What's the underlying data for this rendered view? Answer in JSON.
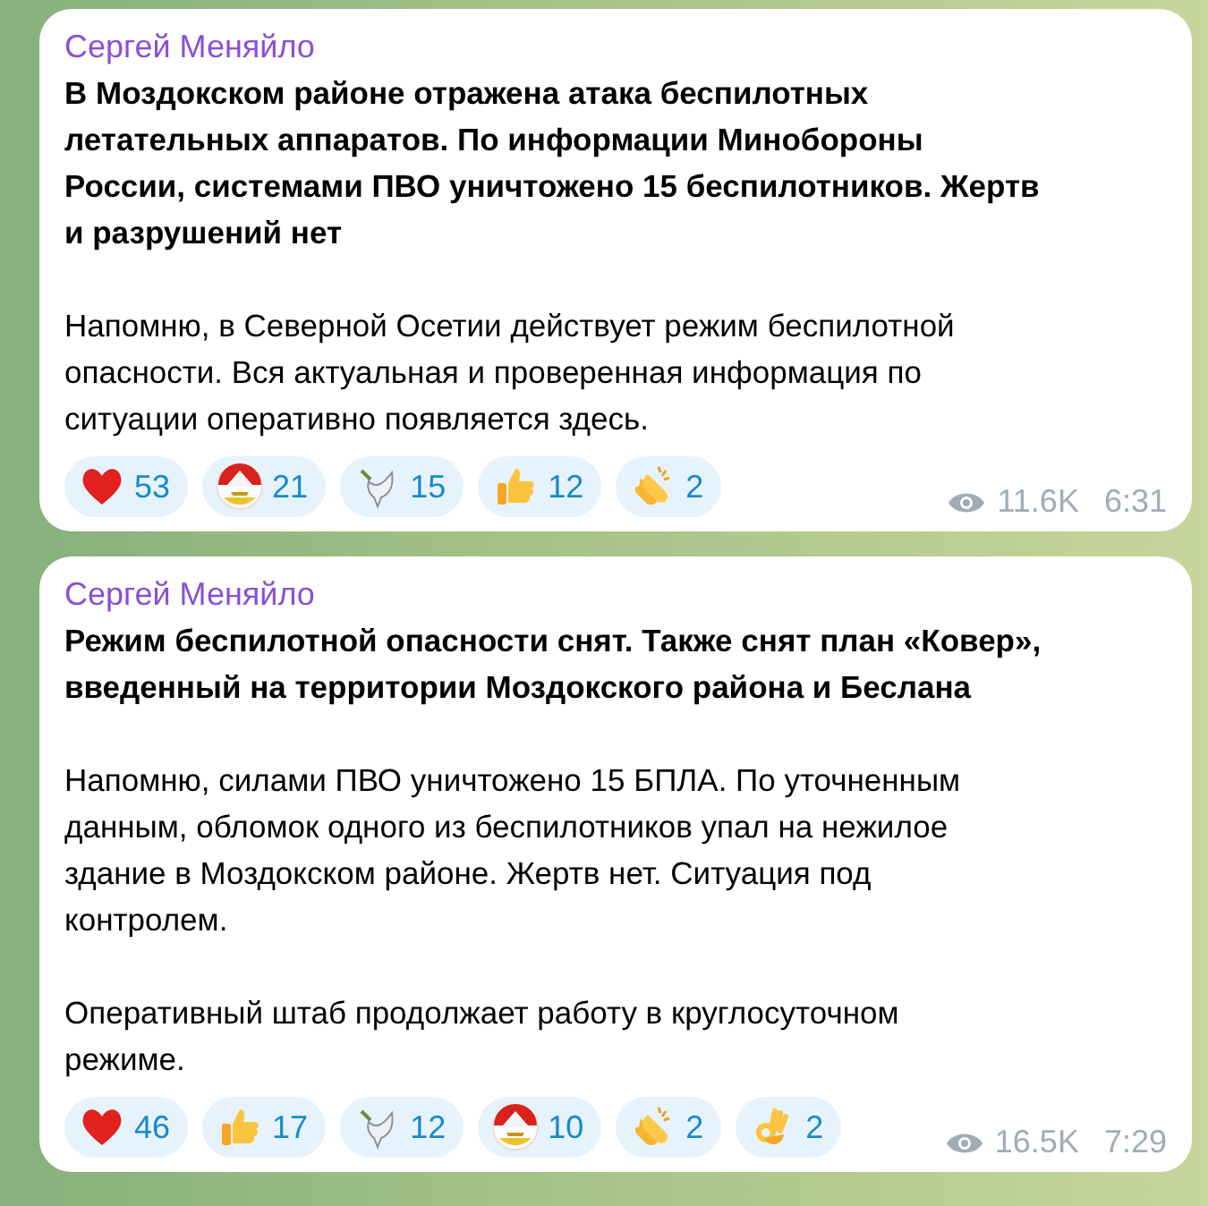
{
  "messages": [
    {
      "author": "Сергей Меняйло",
      "paragraphs": [
        {
          "kind": "headline",
          "text": "В Моздокском районе отражена атака беспилотных\nлетательных аппаратов. По информации Минобороны\nРоссии, системами ПВО уничтожено 15 беспилотников. Жертв\nи разрушений нет"
        },
        {
          "kind": "body",
          "text": "Напомню, в Северной Осетии действует режим беспилотной\nопасности. Вся актуальная и проверенная информация по\nситуации оперативно появляется здесь."
        }
      ],
      "reactions": [
        {
          "kind": "heart",
          "count": "53"
        },
        {
          "kind": "emblem",
          "count": "21"
        },
        {
          "kind": "dove",
          "count": "15"
        },
        {
          "kind": "thumbs",
          "count": "12"
        },
        {
          "kind": "clap",
          "count": "2"
        }
      ],
      "views": "11.6K",
      "time": "6:31"
    },
    {
      "author": "Сергей Меняйло",
      "paragraphs": [
        {
          "kind": "headline",
          "text": "Режим беспилотной опасности снят. Также снят план «Ковер»,\nвведенный на территории Моздокского района и Беслана"
        },
        {
          "kind": "body",
          "text": "Напомню, силами ПВО уничтожено 15 БПЛА. По уточненным\nданным, обломок одного из беспилотников упал на нежилое\nздание в Моздокском районе. Жертв нет. Ситуация под\nконтролем."
        },
        {
          "kind": "body",
          "text": "Оперативный штаб продолжает работу в круглосуточном\nрежиме."
        }
      ],
      "reactions": [
        {
          "kind": "heart",
          "count": "46"
        },
        {
          "kind": "thumbs",
          "count": "17"
        },
        {
          "kind": "dove",
          "count": "12"
        },
        {
          "kind": "emblem",
          "count": "10"
        },
        {
          "kind": "clap",
          "count": "2"
        },
        {
          "kind": "ok",
          "count": "2"
        }
      ],
      "views": "16.5K",
      "time": "7:29"
    }
  ]
}
